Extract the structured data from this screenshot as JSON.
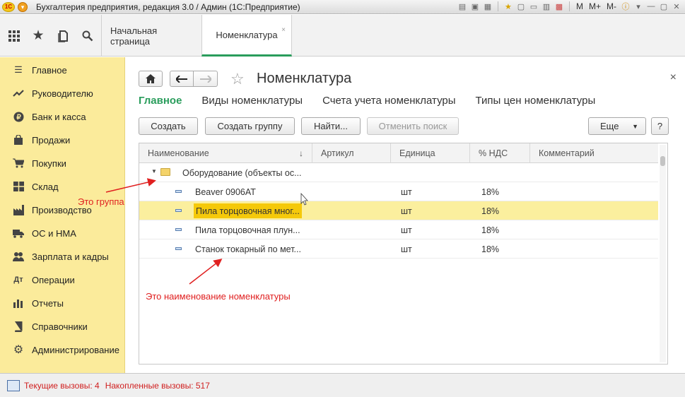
{
  "titlebar": {
    "logo": "1С",
    "title": "Бухгалтерия предприятия, редакция 3.0 / Админ  (1С:Предприятие)",
    "right_items": [
      "M",
      "M+",
      "M-"
    ]
  },
  "topbar": {
    "tabs": [
      {
        "label": "Начальная страница"
      },
      {
        "label": "Номенклатура",
        "active": true,
        "close": "×"
      }
    ]
  },
  "sidebar": {
    "items": [
      {
        "label": "Главное",
        "icon": "menu-icon"
      },
      {
        "label": "Руководителю",
        "icon": "trend-icon"
      },
      {
        "label": "Банк и касса",
        "icon": "coin-icon"
      },
      {
        "label": "Продажи",
        "icon": "bag-icon"
      },
      {
        "label": "Покупки",
        "icon": "cart-icon"
      },
      {
        "label": "Склад",
        "icon": "warehouse-icon"
      },
      {
        "label": "Производство",
        "icon": "factory-icon"
      },
      {
        "label": "ОС и НМА",
        "icon": "truck-icon"
      },
      {
        "label": "Зарплата и кадры",
        "icon": "people-icon"
      },
      {
        "label": "Операции",
        "icon": "operations-icon"
      },
      {
        "label": "Отчеты",
        "icon": "chart-icon"
      },
      {
        "label": "Справочники",
        "icon": "book-icon"
      },
      {
        "label": "Администрирование",
        "icon": "gear-icon"
      }
    ]
  },
  "main": {
    "title": "Номенклатура",
    "close": "×",
    "sections": [
      {
        "label": "Главное",
        "active": true
      },
      {
        "label": "Виды номенклатуры"
      },
      {
        "label": "Счета учета номенклатуры"
      },
      {
        "label": "Типы цен номенклатуры"
      }
    ],
    "buttons": {
      "create": "Создать",
      "create_group": "Создать группу",
      "find": "Найти...",
      "cancel_search": "Отменить поиск",
      "more": "Еще",
      "help": "?"
    },
    "table": {
      "columns": [
        "Наименование",
        "Артикул",
        "Единица",
        "% НДС",
        "Комментарий"
      ],
      "group_row": {
        "name": "Оборудование (объекты ос..."
      },
      "rows": [
        {
          "name": "Beaver 0906AT",
          "article": "",
          "unit": "шт",
          "vat": "18%",
          "comment": ""
        },
        {
          "name": "Пила торцовочная мног...",
          "article": "",
          "unit": "шт",
          "vat": "18%",
          "comment": "",
          "selected": true
        },
        {
          "name": "Пила торцовочная плун...",
          "article": "",
          "unit": "шт",
          "vat": "18%",
          "comment": ""
        },
        {
          "name": "Станок токарный по мет...",
          "article": "",
          "unit": "шт",
          "vat": "18%",
          "comment": ""
        }
      ]
    }
  },
  "annotations": {
    "group": "Это группа",
    "item": "Это наименование номенклатуры"
  },
  "status": {
    "current_calls": "Текущие вызовы: 4",
    "accumulated_calls": "Накопленные вызовы: 517"
  },
  "colors": {
    "sidebar_bg": "#fbeb9b",
    "accent_green": "#2a9d5c",
    "selection": "#fbef9e",
    "annotation": "#e02020"
  }
}
